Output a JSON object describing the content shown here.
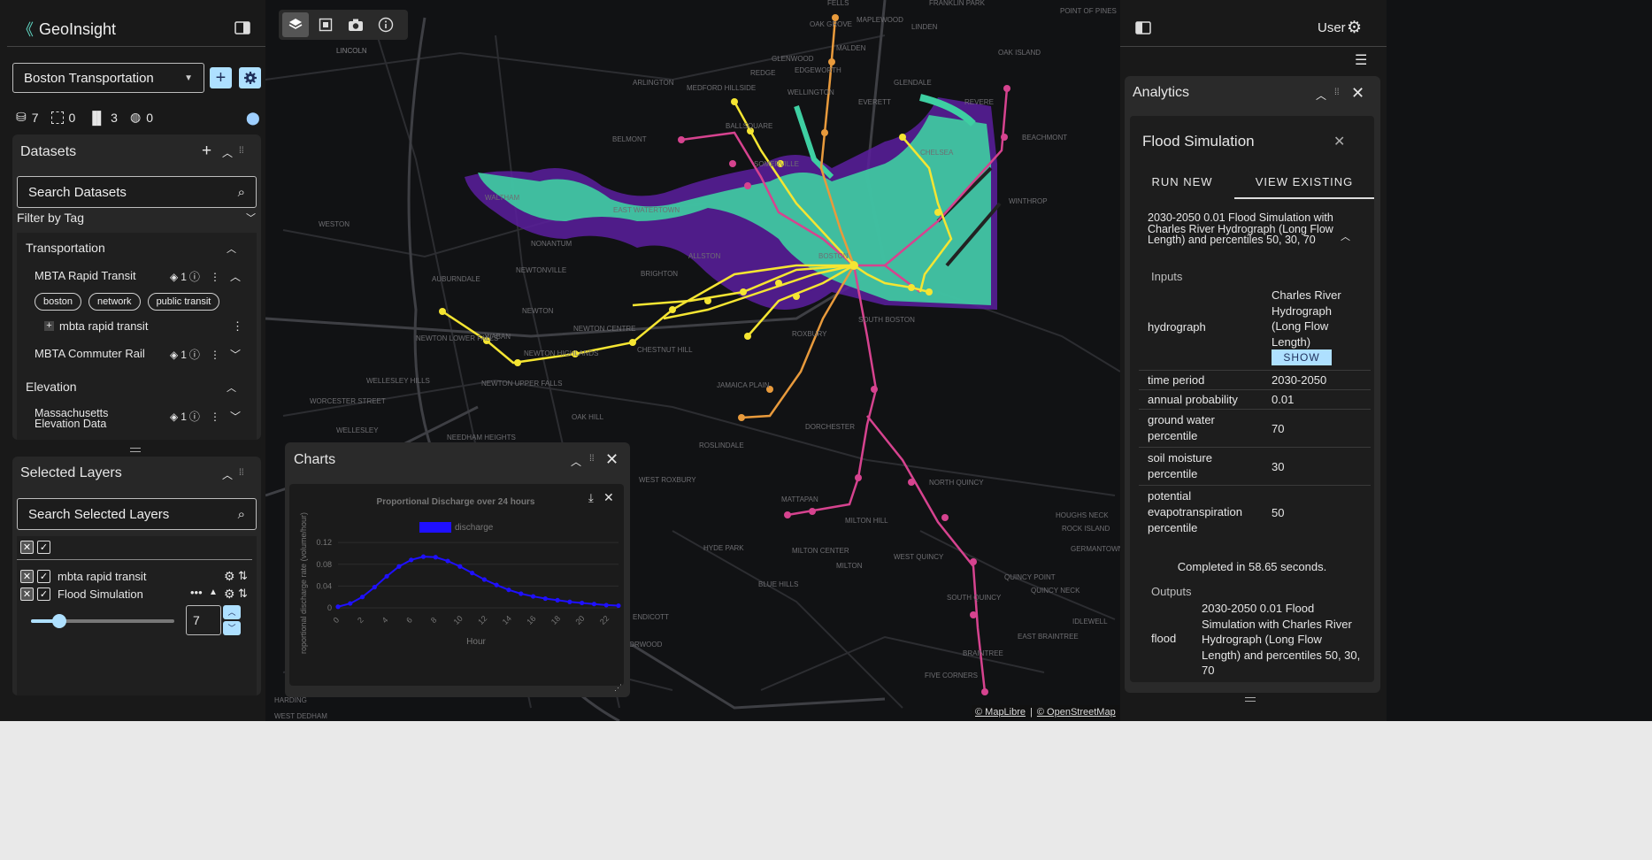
{
  "map": {
    "places": [
      "FELLS",
      "OAK GROVE",
      "MAPLEWOOD",
      "FRANKLIN PARK",
      "POINT OF PINES",
      "LINDEN",
      "MALDEN",
      "LINCOLN",
      "OAK ISLAND",
      "GLENWOOD",
      "EDGEWORTH",
      "REDGE",
      "ARLINGTON",
      "MEDFORD HILLSIDE",
      "GLENDALE",
      "WELLINGTON",
      "EVERETT",
      "REVERE",
      "BEACHMONT",
      "BELMONT",
      "BALLSQUARE",
      "SOMERVILLE",
      "CHELSEA",
      "WINTHROP",
      "WALTHAM",
      "EAST WATERTOWN",
      "WESTON",
      "NONANTUM",
      "ALLSTON",
      "BOSTON",
      "NEWTONVILLE",
      "AUBURNDALE",
      "BRIGHTON",
      "NEWTON",
      "NEWTON CENTRE",
      "SOUTH BOSTON",
      "NEWTON LOWER FALLS",
      "WABAN",
      "NEWTON HIGHLANDS",
      "CHESTNUT HILL",
      "ROXBURY",
      "WELLESLEY HILLS",
      "NEWTON UPPER FALLS",
      "JAMAICA PLAIN",
      "WORCESTER STREET",
      "OAK HILL",
      "DORCHESTER",
      "WELLESLEY",
      "NEEDHAM HEIGHTS",
      "ROSLINDALE",
      "WEST ROXBURY",
      "NORTH QUINCY",
      "MATTAPAN",
      "HOUGHS NECK",
      "ROCK ISLAND",
      "MILTON HILL",
      "GERMANTOWN",
      "HYDE PARK",
      "MILTON CENTER",
      "WEST QUINCY",
      "QUINCY POINT",
      "MILTON",
      "BLUE HILLS",
      "QUINCY NECK",
      "ENDICOTT",
      "IDLEWELL",
      "EAST BRAINTREE",
      "NORWOOD",
      "BRAINTREE",
      "FIVE CORNERS",
      "HARDING",
      "WEST DEDHAM",
      "SOUTH QUINCY",
      "LINCOLN"
    ],
    "attribution": [
      "© MapLibre",
      "© OpenStreetMap"
    ]
  },
  "toolbar": {
    "buttons": [
      "layers-icon",
      "box-select-icon",
      "camera-icon",
      "info-icon"
    ]
  },
  "left": {
    "app_name": "GeoInsight",
    "project": "Boston Transportation",
    "stats": {
      "datasets": "7",
      "regions": "0",
      "charts": "3",
      "networks": "0"
    },
    "datasets": {
      "title": "Datasets",
      "search_placeholder": "Search Datasets",
      "filter_label": "Filter by Tag",
      "groups": [
        {
          "name": "Transportation",
          "items": [
            {
              "name": "MBTA Rapid Transit",
              "count": "1",
              "tags": [
                "boston",
                "network",
                "public transit"
              ],
              "layer": "mbta rapid transit"
            },
            {
              "name": "MBTA Commuter Rail",
              "count": "1"
            }
          ]
        },
        {
          "name": "Elevation",
          "items": [
            {
              "name": "Massachusetts Elevation Data",
              "count": "1"
            }
          ]
        }
      ]
    },
    "selected": {
      "title": "Selected Layers",
      "search_placeholder": "Search Selected Layers",
      "layers": [
        "mbta rapid transit",
        "Flood Simulation"
      ],
      "slider_value": 0.2,
      "stepper_value": "7"
    }
  },
  "charts": {
    "title": "Charts",
    "chart_title": "Proportional Discharge over 24 hours",
    "legend": "discharge",
    "xlabel": "Hour",
    "ylabel": "roportional discharge rate (volume/hour)",
    "series_color": "#1f10ff"
  },
  "chart_data": {
    "type": "line",
    "title": "Proportional Discharge over 24 hours",
    "xlabel": "Hour",
    "ylabel": "roportional discharge rate (volume/hour)",
    "x": [
      0,
      1,
      2,
      3,
      4,
      5,
      6,
      7,
      8,
      9,
      10,
      11,
      12,
      13,
      14,
      15,
      16,
      17,
      18,
      19,
      20,
      21,
      22,
      23
    ],
    "series": [
      {
        "name": "discharge",
        "values": [
          0.002,
          0.008,
          0.02,
          0.038,
          0.058,
          0.076,
          0.088,
          0.094,
          0.093,
          0.086,
          0.076,
          0.064,
          0.052,
          0.042,
          0.033,
          0.026,
          0.021,
          0.017,
          0.014,
          0.011,
          0.009,
          0.007,
          0.005,
          0.004
        ]
      }
    ],
    "xticks": [
      "0",
      "2",
      "4",
      "6",
      "8",
      "10",
      "12",
      "14",
      "16",
      "18",
      "20",
      "22"
    ],
    "yticks": [
      "0",
      "0.04",
      "0.08",
      "0.12"
    ],
    "xlim": [
      0,
      23
    ],
    "ylim": [
      0,
      0.13
    ],
    "legend_position": "top"
  },
  "right": {
    "user_label": "User",
    "analytics_title": "Analytics",
    "flood": {
      "title": "Flood Simulation",
      "tabs": [
        "RUN NEW",
        "VIEW EXISTING"
      ],
      "result_title": "2030-2050 0.01 Flood Simulation with Charles River Hydrograph (Long Flow Length) and percentiles 50, 30, 70",
      "inputs_label": "Inputs",
      "inputs": [
        {
          "key": "hydrograph",
          "value": "Charles River Hydrograph (Long Flow Length)",
          "button": "SHOW"
        },
        {
          "key": "time period",
          "value": "2030-2050"
        },
        {
          "key": "annual probability",
          "value": "0.01"
        },
        {
          "key": "ground water percentile",
          "value": "70"
        },
        {
          "key": "soil moisture percentile",
          "value": "30"
        },
        {
          "key": "potential evapotranspiration percentile",
          "value": "50"
        }
      ],
      "completed": "Completed in 58.65 seconds.",
      "outputs_label": "Outputs",
      "outputs": [
        {
          "key": "flood",
          "value": "2030-2050 0.01 Flood Simulation with Charles River Hydrograph (Long Flow Length) and percentiles 50, 30, 70"
        }
      ]
    }
  }
}
